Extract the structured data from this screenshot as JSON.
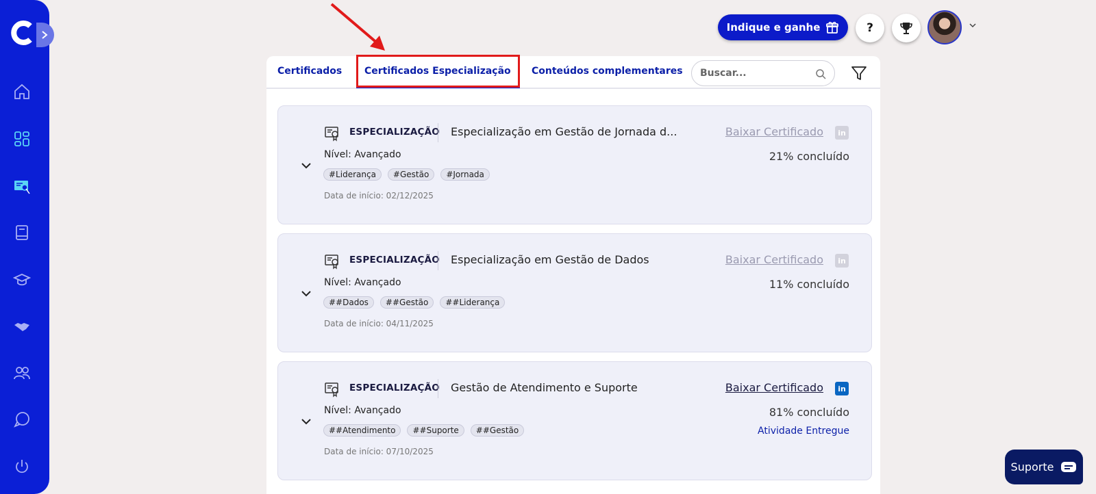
{
  "sidebar": {
    "logo": "c-logo-icon",
    "expand_icon": "chevron-right-icon",
    "items": [
      {
        "icon": "home-icon"
      },
      {
        "icon": "dashboard-icon"
      },
      {
        "icon": "certificate-icon"
      },
      {
        "icon": "book-icon"
      },
      {
        "icon": "graduation-cap-icon"
      },
      {
        "icon": "handshake-icon"
      },
      {
        "icon": "users-icon"
      },
      {
        "icon": "chat-icon"
      },
      {
        "icon": "power-icon"
      }
    ]
  },
  "header": {
    "indique_label": "Indique e ganhe",
    "help_label": "?"
  },
  "tabs": [
    {
      "label": "Certificados"
    },
    {
      "label": "Certificados Especialização",
      "active": true
    },
    {
      "label": "Conteúdos complementares"
    }
  ],
  "search": {
    "placeholder": "Buscar..."
  },
  "cards": [
    {
      "type": "ESPECIALIZAÇÃO",
      "title": "Especialização em Gestão de Jornada d...",
      "download_label": "Baixar Certificado",
      "download_enabled": false,
      "level": "Nível: Avançado",
      "progress": "21% concluído",
      "status": "",
      "tags": [
        "#Liderança",
        "#Gestão",
        "#Jornada"
      ],
      "start_date": "Data de início: 02/12/2025"
    },
    {
      "type": "ESPECIALIZAÇÃO",
      "title": "Especialização em Gestão de Dados",
      "download_label": "Baixar Certificado",
      "download_enabled": false,
      "level": "Nível: Avançado",
      "progress": "11% concluído",
      "status": "",
      "tags": [
        "##Dados",
        "##Gestão",
        "##Liderança"
      ],
      "start_date": "Data de início: 04/11/2025"
    },
    {
      "type": "ESPECIALIZAÇÃO",
      "title": "Gestão de Atendimento e Suporte",
      "download_label": "Baixar Certificado",
      "download_enabled": true,
      "level": "Nível: Avançado",
      "progress": "81% concluído",
      "status": "Atividade Entregue",
      "tags": [
        "##Atendimento",
        "##Suporte",
        "##Gestão"
      ],
      "start_date": "Data de início: 07/10/2025"
    }
  ],
  "suporte": {
    "label": "Suporte"
  },
  "colors": {
    "sidebar": "#0b1fd6",
    "accent": "#0c1bc9",
    "highlight": "#e11a1a",
    "linkedin": "#0a66c2",
    "support": "#0a1a63"
  }
}
